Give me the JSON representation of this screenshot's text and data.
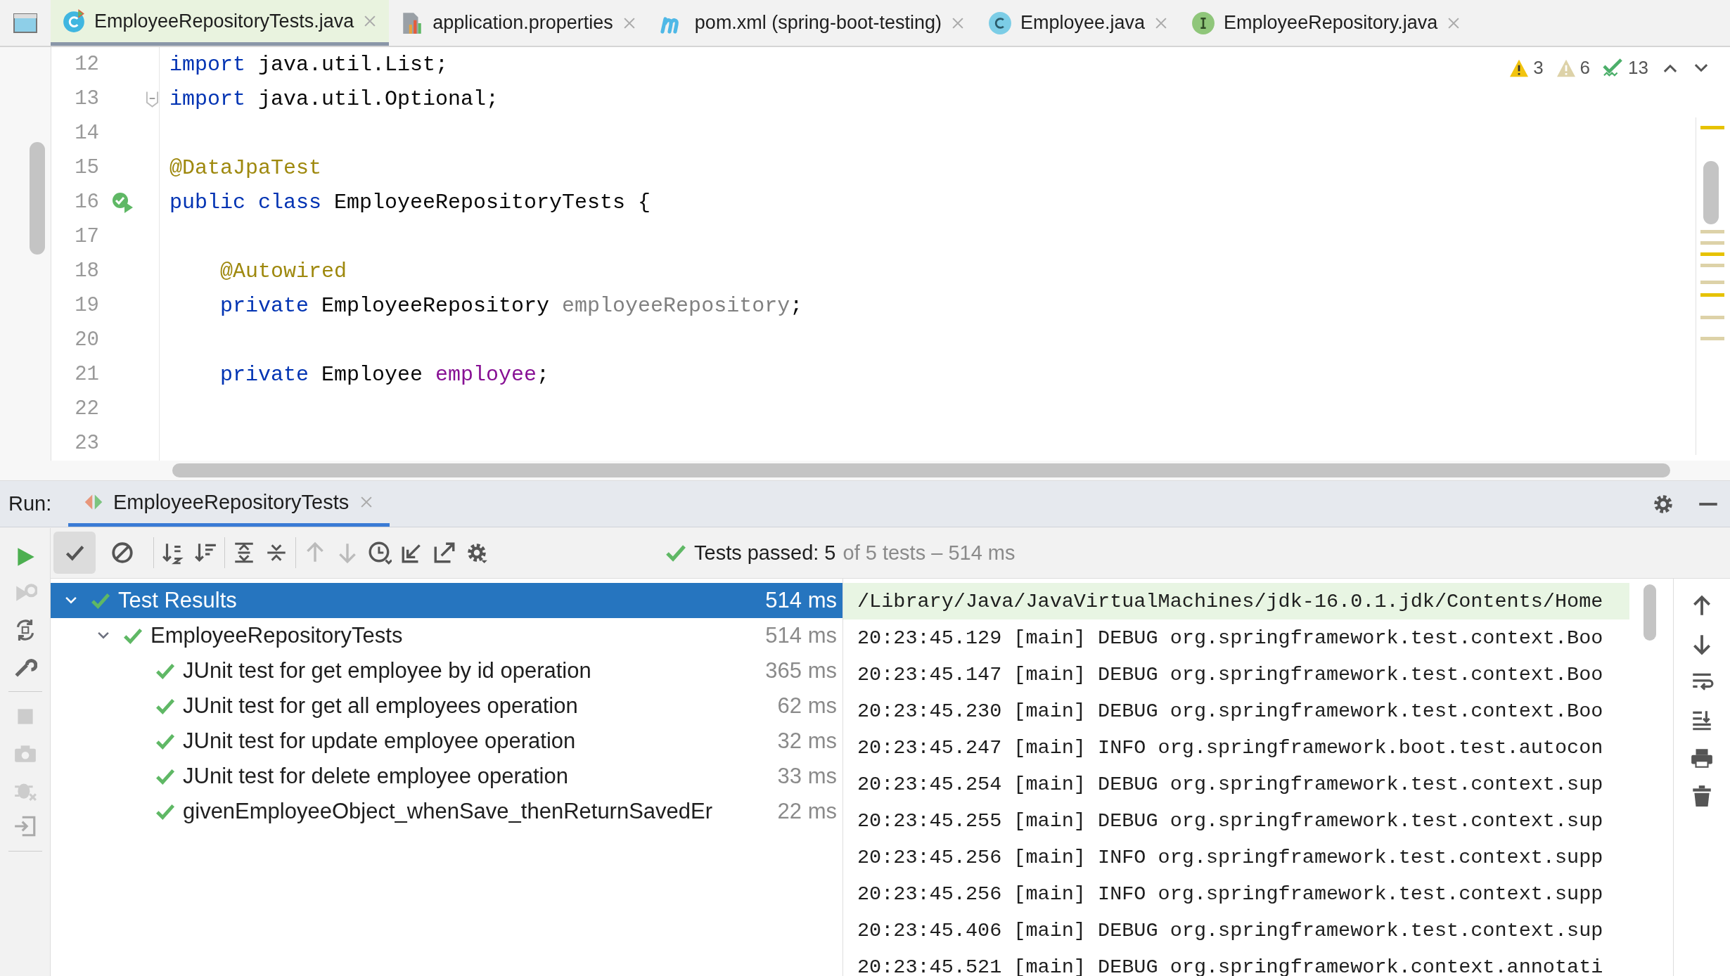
{
  "editor_tabs": [
    {
      "label": "EmployeeRepositoryTests.java",
      "selected": true
    },
    {
      "label": "application.properties",
      "selected": false
    },
    {
      "label": "pom.xml (spring-boot-testing)",
      "selected": false
    },
    {
      "label": "Employee.java",
      "selected": false
    },
    {
      "label": "EmployeeRepository.java",
      "selected": false
    }
  ],
  "inspections": [
    {
      "kind": "warning",
      "count": "3"
    },
    {
      "kind": "weak-warning",
      "count": "6"
    },
    {
      "kind": "typo",
      "count": "13"
    }
  ],
  "code_lines": [
    {
      "number": "12",
      "kind": "top",
      "tokens": [
        {
          "text": "import",
          "kind": "keyword"
        },
        {
          "text": " java.util.List;",
          "kind": "plain"
        }
      ]
    },
    {
      "number": "13",
      "kind": "top",
      "tokens": [
        {
          "text": "import",
          "kind": "keyword"
        },
        {
          "text": " java.util.Optional;",
          "kind": "plain"
        }
      ]
    },
    {
      "number": "14"
    },
    {
      "number": "15",
      "kind": "top",
      "tokens": [
        {
          "text": "@DataJpaTest",
          "kind": "annotation"
        }
      ]
    },
    {
      "number": "16",
      "kind": "top",
      "tokens": [
        {
          "text": "public class",
          "kind": "keyword"
        },
        {
          "text": " EmployeeRepositoryTests {",
          "kind": "plain"
        }
      ]
    },
    {
      "number": "17"
    },
    {
      "number": "18",
      "kind": "member",
      "tokens": [
        {
          "text": "@Autowired",
          "kind": "annotation"
        }
      ]
    },
    {
      "number": "19",
      "kind": "member",
      "tokens": [
        {
          "text": "private",
          "kind": "keyword"
        },
        {
          "text": " EmployeeRepository ",
          "kind": "plain"
        },
        {
          "text": "employeeRepository",
          "kind": "unused"
        },
        {
          "text": ";",
          "kind": "plain"
        }
      ]
    },
    {
      "number": "20"
    },
    {
      "number": "21",
      "kind": "member",
      "tokens": [
        {
          "text": "private",
          "kind": "keyword"
        },
        {
          "text": " Employee ",
          "kind": "plain"
        },
        {
          "text": "employee",
          "kind": "field"
        },
        {
          "text": ";",
          "kind": "plain"
        }
      ]
    },
    {
      "number": "22"
    },
    {
      "number": "23"
    }
  ],
  "run_panel": {
    "label": "Run:",
    "tab": "EmployeeRepositoryTests",
    "toggles": [
      {
        "kind": "show-passed",
        "selected": true
      },
      {
        "kind": "show-ignored",
        "selected": false
      }
    ],
    "status": {
      "passed": "Tests passed: 5",
      "rest": "of 5 tests – 514 ms"
    }
  },
  "test_tree": [
    {
      "label": "Test Results",
      "time": "514 ms",
      "selected": true,
      "expanded": true,
      "children": [
        {
          "label": "EmployeeRepositoryTests",
          "time": "514 ms",
          "selected": false,
          "expanded": true,
          "children": [
            {
              "label": "JUnit test for get employee by id operation",
              "time": "365 ms",
              "selected": false
            },
            {
              "label": "JUnit test for get all employees operation",
              "time": "62 ms",
              "selected": false
            },
            {
              "label": "JUnit test for update employee operation",
              "time": "32 ms",
              "selected": false
            },
            {
              "label": "JUnit test for delete employee operation",
              "time": "33 ms",
              "selected": false
            },
            {
              "label": "givenEmployeeObject_whenSave_thenReturnSavedEr",
              "time": "22 ms",
              "selected": false
            }
          ]
        }
      ]
    }
  ],
  "console": [
    {
      "kind": "command",
      "text": "/Library/Java/JavaVirtualMachines/jdk-16.0.1.jdk/Contents/Home"
    },
    {
      "kind": "log",
      "text": "20:23:45.129 [main] DEBUG org.springframework.test.context.Boo"
    },
    {
      "kind": "log",
      "text": "20:23:45.147 [main] DEBUG org.springframework.test.context.Boo"
    },
    {
      "kind": "log",
      "text": "20:23:45.230 [main] DEBUG org.springframework.test.context.Boo"
    },
    {
      "kind": "log",
      "text": "20:23:45.247 [main] INFO org.springframework.boot.test.autocon"
    },
    {
      "kind": "log",
      "text": "20:23:45.254 [main] DEBUG org.springframework.test.context.sup"
    },
    {
      "kind": "log",
      "text": "20:23:45.255 [main] DEBUG org.springframework.test.context.sup"
    },
    {
      "kind": "log",
      "text": "20:23:45.256 [main] INFO org.springframework.test.context.supp"
    },
    {
      "kind": "log",
      "text": "20:23:45.256 [main] INFO org.springframework.test.context.supp"
    },
    {
      "kind": "log",
      "text": "20:23:45.406 [main] DEBUG org.springframework.test.context.sup"
    },
    {
      "kind": "log",
      "text": "20:23:45.521 [main] DEBUG org.springframework.context.annotati"
    }
  ]
}
